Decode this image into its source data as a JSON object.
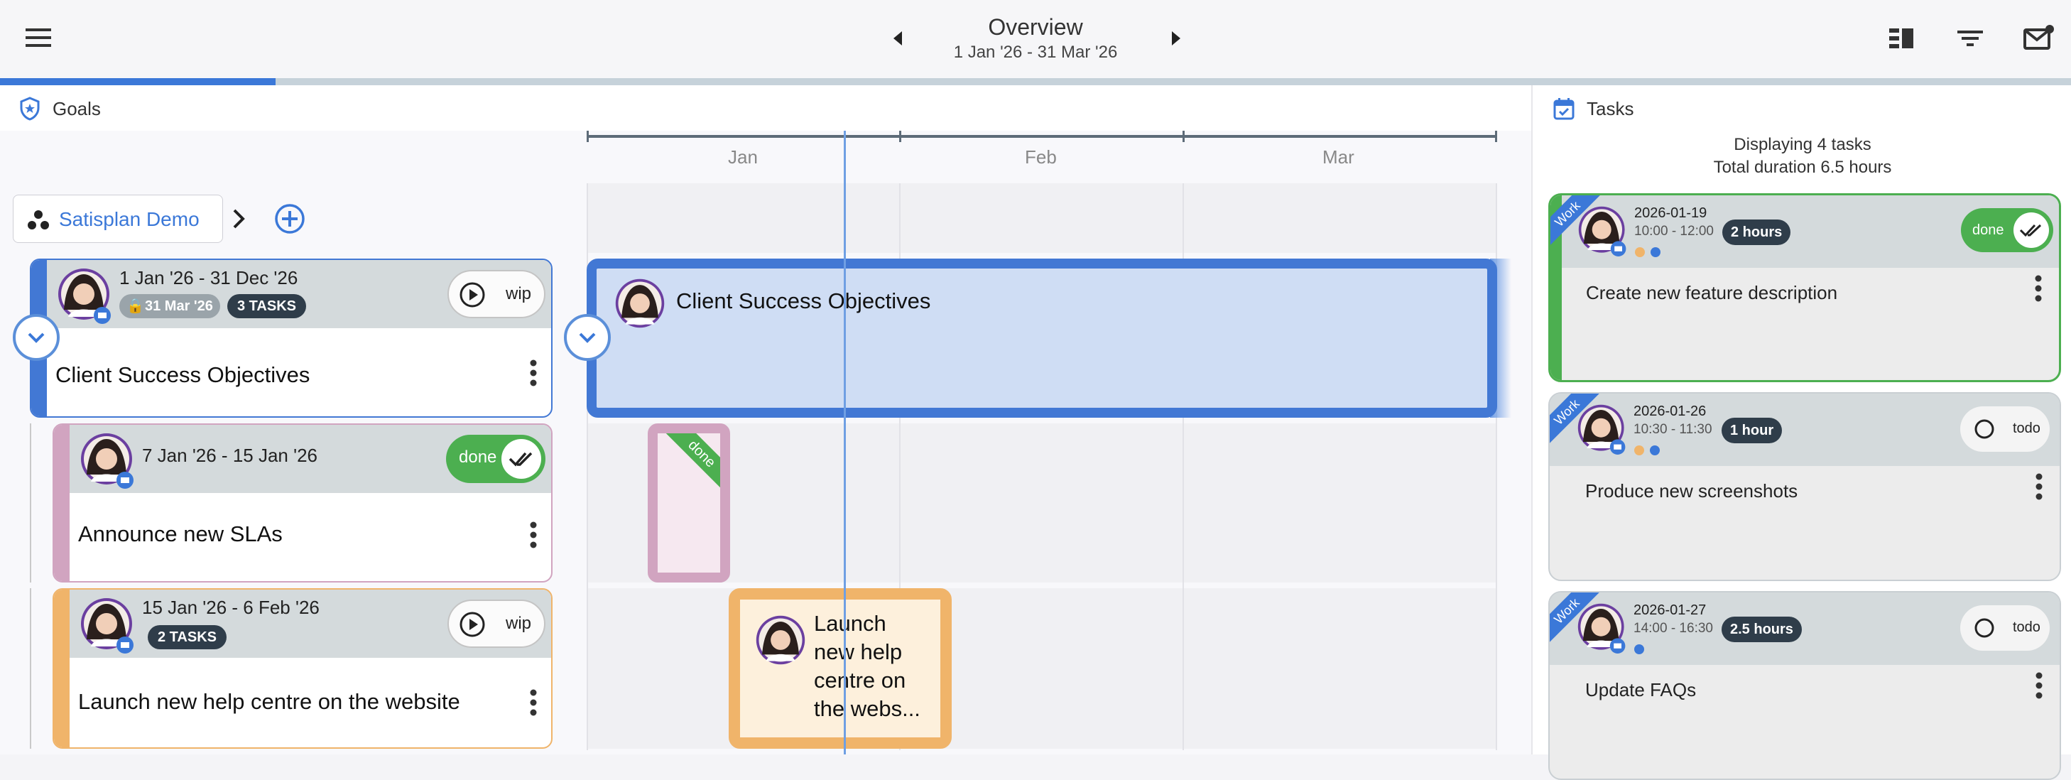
{
  "header": {
    "title": "Overview",
    "date_range": "1 Jan '26 - 31 Mar '26",
    "progress_fraction": 0.133
  },
  "icons": {
    "menu": "hamburger-icon",
    "prev": "caret-left-icon",
    "next": "caret-right-icon",
    "view": "view-list-icon",
    "filter": "filter-icon",
    "inbox": "mail-notification-icon"
  },
  "colors": {
    "accent": "#3b78d8",
    "done": "#4caf50",
    "goal_main": "#4278d4",
    "goal_sla": "#d1a4c0",
    "goal_help": "#f0b46a"
  },
  "goals": {
    "heading": "Goals",
    "breadcrumb": "Satisplan Demo",
    "months": [
      "Jan",
      "Feb",
      "Mar"
    ],
    "items": [
      {
        "dates": "1 Jan '26 - 31 Dec '26",
        "deadline": "31 Mar '26",
        "tasks": "3 TASKS",
        "status": "wip",
        "title": "Client Success Objectives"
      },
      {
        "dates": "7 Jan '26 - 15 Jan '26",
        "status": "done",
        "title": "Announce new SLAs"
      },
      {
        "dates": "15 Jan '26 - 6 Feb '26",
        "tasks": "2 TASKS",
        "status": "wip",
        "title": "Launch new help centre on the website"
      }
    ],
    "timeline": {
      "bar_main_title": "Client Success Objectives",
      "bar_sla_ribbon": "done",
      "bar_help_title": "Launch new help centre on the webs..."
    }
  },
  "tasks": {
    "heading": "Tasks",
    "summary_line1": "Displaying 4 tasks",
    "summary_line2": "Total duration 6.5 hours",
    "items": [
      {
        "tag": "Work",
        "date": "2026-01-19",
        "time": "10:00 - 12:00",
        "duration": "2 hours",
        "status": "done",
        "title": "Create new feature description"
      },
      {
        "tag": "Work",
        "date": "2026-01-26",
        "time": "10:30 - 11:30",
        "duration": "1 hour",
        "status": "todo",
        "title": "Produce new screenshots"
      },
      {
        "tag": "Work",
        "date": "2026-01-27",
        "time": "14:00 - 16:30",
        "duration": "2.5 hours",
        "status": "todo",
        "title": "Update FAQs"
      }
    ]
  }
}
